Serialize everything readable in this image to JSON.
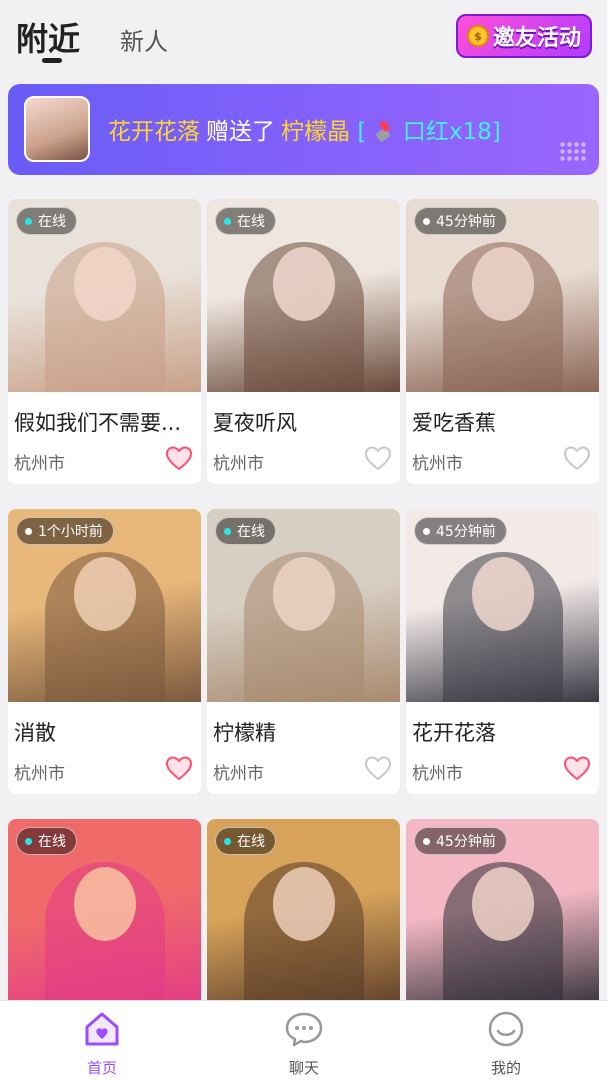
{
  "header": {
    "tab_active": "附近",
    "tab_inactive": "新人",
    "invite_label": "邀友活动",
    "invite_coin": "$"
  },
  "banner": {
    "sender": "花开花落",
    "verb": "赠送了",
    "receiver": "柠檬晶",
    "gift_open": "[",
    "gift_icon": "lipstick-icon",
    "gift": "口红x18",
    "gift_close": "]"
  },
  "cards": [
    {
      "name": "假如我们不需要...",
      "city": "杭州市",
      "status": "在线",
      "online": true,
      "liked": true
    },
    {
      "name": "夏夜听风",
      "city": "杭州市",
      "status": "在线",
      "online": true,
      "liked": false
    },
    {
      "name": "爱吃香蕉",
      "city": "杭州市",
      "status": "45分钟前",
      "online": false,
      "liked": false
    },
    {
      "name": "消散",
      "city": "杭州市",
      "status": "1个小时前",
      "online": false,
      "liked": true
    },
    {
      "name": "柠檬精",
      "city": "杭州市",
      "status": "在线",
      "online": true,
      "liked": false
    },
    {
      "name": "花开花落",
      "city": "杭州市",
      "status": "45分钟前",
      "online": false,
      "liked": true
    },
    {
      "name": "",
      "city": "",
      "status": "在线",
      "online": true,
      "liked": false
    },
    {
      "name": "",
      "city": "",
      "status": "在线",
      "online": true,
      "liked": false
    },
    {
      "name": "",
      "city": "",
      "status": "45分钟前",
      "online": false,
      "liked": false
    }
  ],
  "nav": {
    "home": "首页",
    "chat": "聊天",
    "mine": "我的"
  },
  "colors": {
    "accent": "#9b4dff",
    "online_dot": "#27e6e6",
    "offline_dot": "#ffffff",
    "heart_liked": "#ff4d6d",
    "heart_empty": "#c8c8c8",
    "banner_highlight": "#ffd62e",
    "banner_gift": "#3ff2ff"
  }
}
